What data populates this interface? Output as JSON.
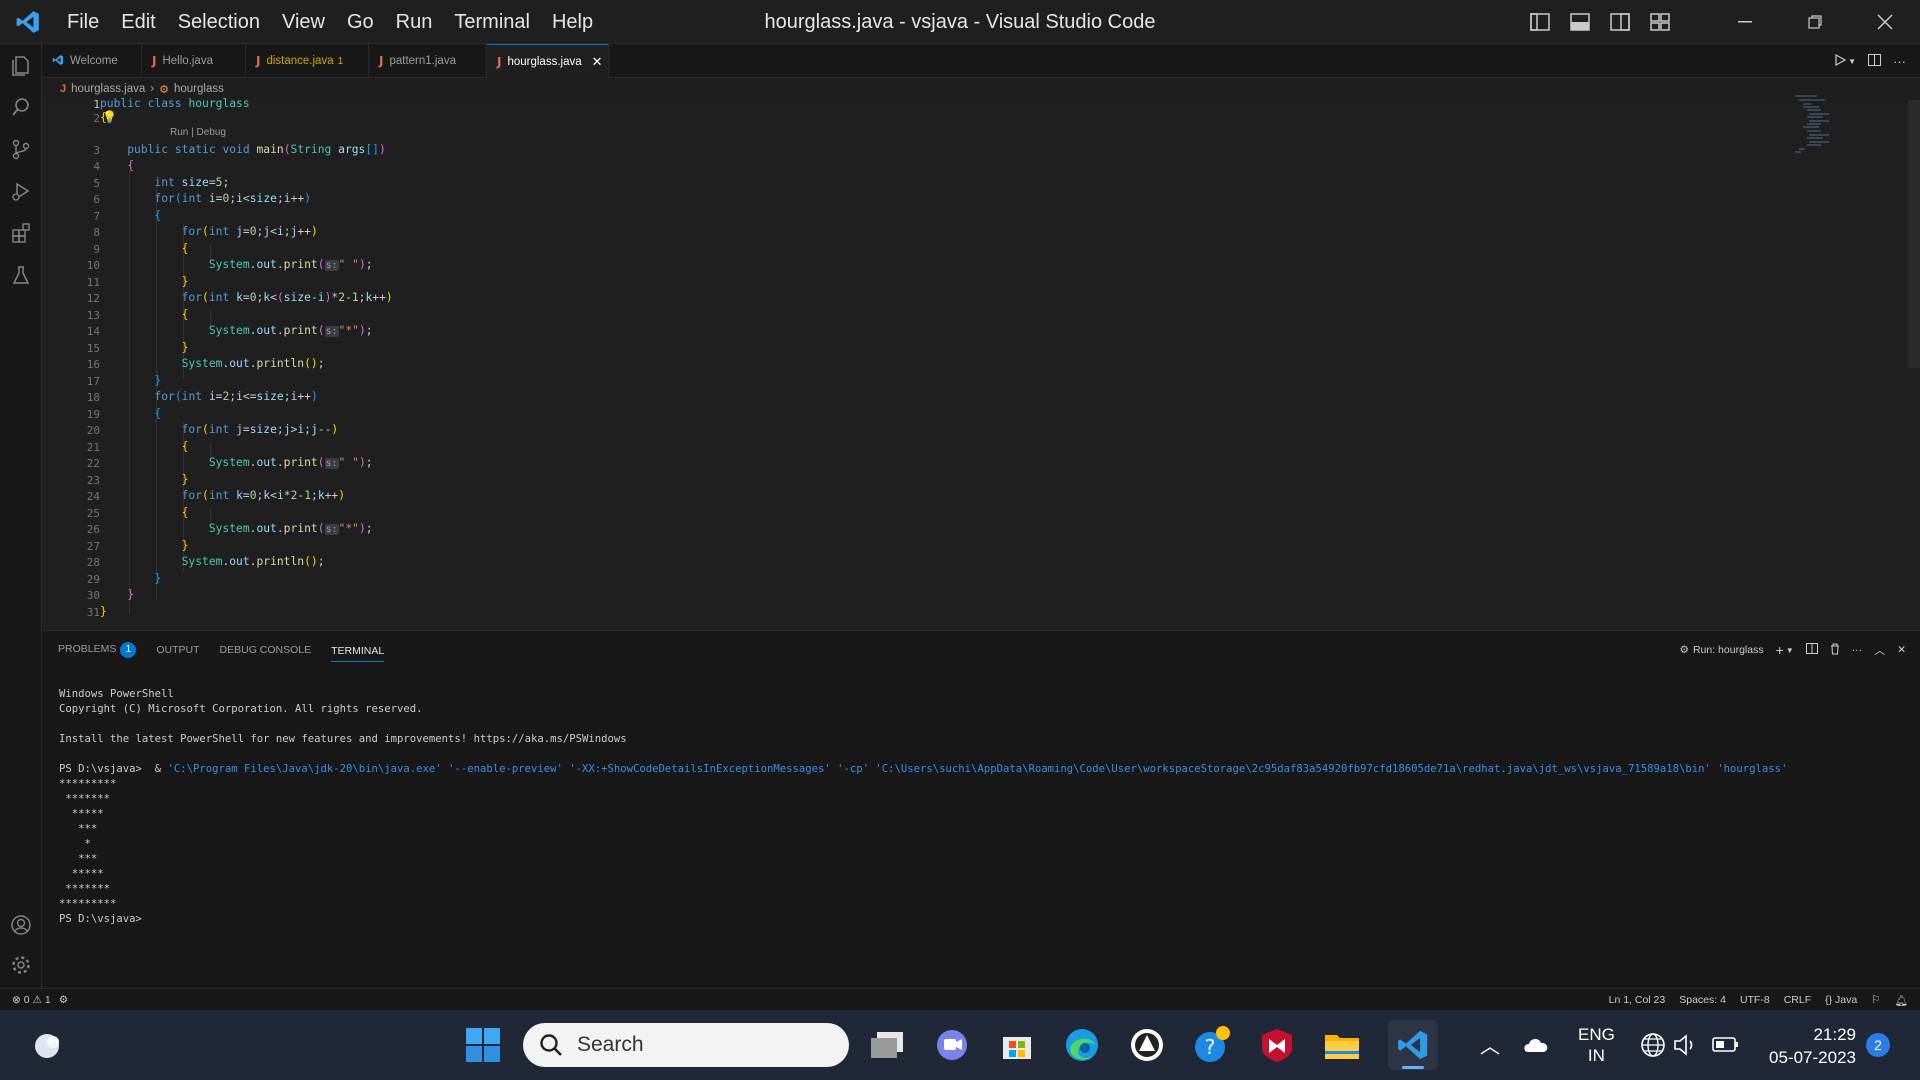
{
  "window": {
    "title": "hourglass.java - vsjava - Visual Studio Code"
  },
  "menu": [
    "File",
    "Edit",
    "Selection",
    "View",
    "Go",
    "Run",
    "Terminal",
    "Help"
  ],
  "tabs": [
    {
      "label": "Welcome",
      "icon": "vscode-icon"
    },
    {
      "label": "Hello.java",
      "icon": "java-icon"
    },
    {
      "label": "distance.java",
      "badge": "1",
      "icon": "java-icon"
    },
    {
      "label": "pattern1.java",
      "icon": "java-icon"
    },
    {
      "label": "hourglass.java",
      "icon": "java-icon",
      "active": true
    }
  ],
  "breadcrumb": {
    "file": "hourglass.java",
    "symbol": "hourglass"
  },
  "editor": {
    "codelens": "Run | Debug",
    "line_numbers": [
      "1",
      "2",
      "3",
      "4",
      "5",
      "6",
      "7",
      "8",
      "9",
      "10",
      "11",
      "12",
      "13",
      "14",
      "15",
      "16",
      "17",
      "18",
      "19",
      "20",
      "21",
      "22",
      "23",
      "24",
      "25",
      "26",
      "27",
      "28",
      "29",
      "30",
      "31"
    ],
    "inlay_hint": "s:"
  },
  "panel": {
    "tabs": {
      "problems": "PROBLEMS",
      "problems_count": "1",
      "output": "OUTPUT",
      "debug": "DEBUG CONSOLE",
      "terminal": "TERMINAL"
    },
    "run_label": "Run: hourglass",
    "terminal_lines": [
      "Windows PowerShell",
      "Copyright (C) Microsoft Corporation. All rights reserved.",
      "",
      "Install the latest PowerShell for new features and improvements! https://aka.ms/PSWindows",
      ""
    ],
    "prompt": "PS D:\\vsjava> ",
    "command_amp": " & ",
    "command": "'C:\\Program Files\\Java\\jdk-20\\bin\\java.exe' '--enable-preview' '-XX:+ShowCodeDetailsInExceptionMessages' '-cp' 'C:\\Users\\suchi\\AppData\\Roaming\\Code\\User\\workspaceStorage\\2c95daf83a54920fb97cfd18605de71a\\redhat.java\\jdt_ws\\vsjava_71589a18\\bin' 'hourglass'",
    "output_lines": [
      "*********",
      " *******",
      "  *****",
      "   ***",
      "    *",
      "   ***",
      "  *****",
      " *******",
      "*********"
    ],
    "final_prompt": "PS D:\\vsjava>"
  },
  "statusbar": {
    "errors": "0",
    "warnings": "1",
    "position": "Ln 1, Col 23",
    "spaces": "Spaces: 4",
    "encoding": "UTF-8",
    "eol": "CRLF",
    "language": "Java"
  },
  "taskbar": {
    "search_placeholder": "Search",
    "lang_top": "ENG",
    "lang_bottom": "IN",
    "time": "21:29",
    "date": "05-07-2023",
    "notifications": "2"
  },
  "colors": {
    "accent": "#0078d4",
    "background": "#1f1f1f",
    "taskbar": "#202838"
  }
}
